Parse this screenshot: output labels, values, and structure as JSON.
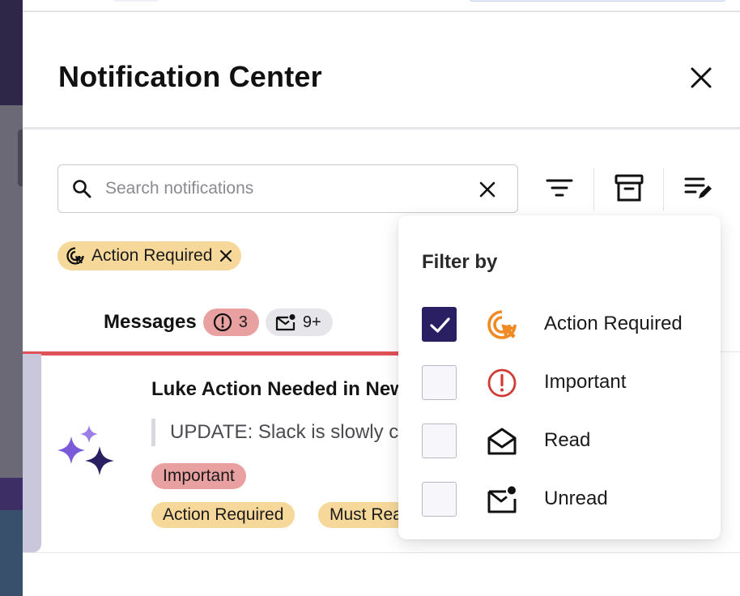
{
  "panel": {
    "title": "Notification Center"
  },
  "search": {
    "placeholder": "Search notifications",
    "value": ""
  },
  "active_filter_chip": {
    "label": "Action Required"
  },
  "tabs": {
    "messages_label": "Messages",
    "important_count": "3",
    "unread_count": "9+"
  },
  "notifications": [
    {
      "title": "Luke Action Needed in New",
      "preview": "UPDATE: Slack is slowly coming back",
      "tags": [
        "Important",
        "Action Required",
        "Must Read"
      ]
    }
  ],
  "filter_menu": {
    "title": "Filter by",
    "options": [
      {
        "label": "Action Required",
        "checked": true,
        "icon": "target-cursor-icon"
      },
      {
        "label": "Important",
        "checked": false,
        "icon": "alert-circle-icon"
      },
      {
        "label": "Read",
        "checked": false,
        "icon": "open-envelope-icon"
      },
      {
        "label": "Unread",
        "checked": false,
        "icon": "unread-envelope-icon"
      }
    ]
  },
  "colors": {
    "action_required": "#f7d89b",
    "important": "#e8a0a0",
    "accent_dark": "#2b1f63",
    "tab_underline": "#e05258",
    "action_icon": "#f08a24",
    "important_icon": "#d23a34"
  }
}
